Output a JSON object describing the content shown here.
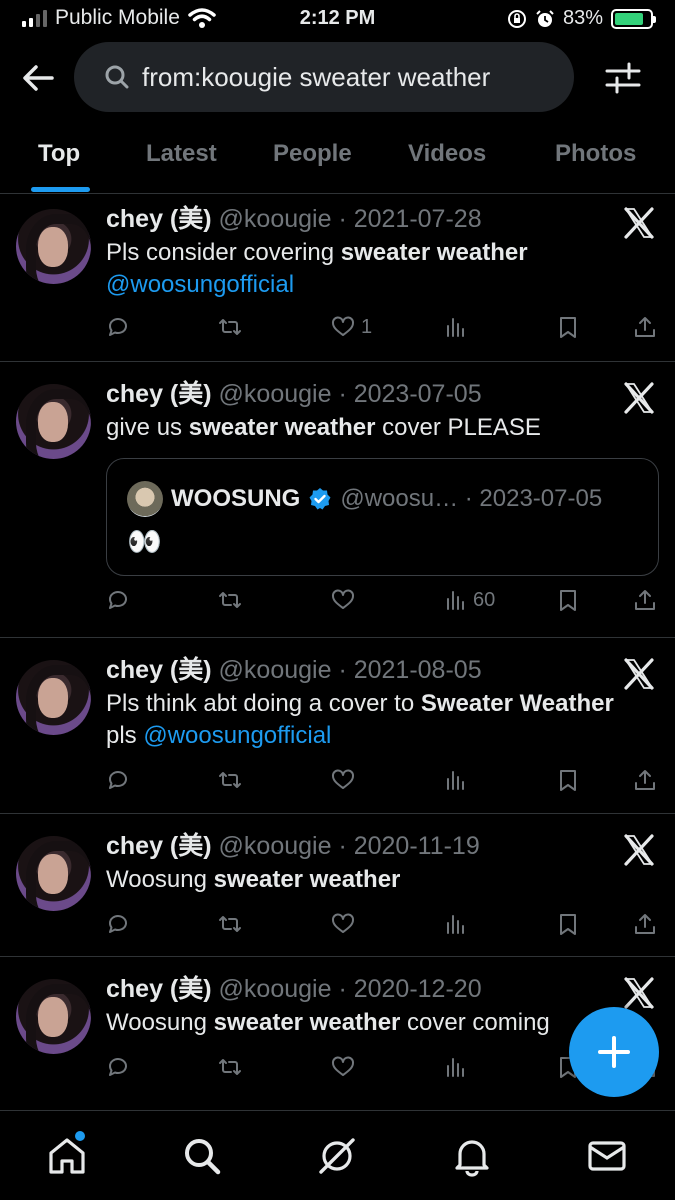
{
  "status_bar": {
    "carrier": "Public Mobile",
    "time": "2:12 PM",
    "battery": "83%",
    "battery_level": 0.83,
    "icons": [
      "signal-icon",
      "wifi-icon",
      "orientation-lock-icon",
      "alarm-icon",
      "battery-charging-icon"
    ]
  },
  "header": {
    "search_query": "from:koougie sweater weather",
    "icons": [
      "back-arrow-icon",
      "search-icon",
      "filter-sliders-icon"
    ]
  },
  "tabs": [
    {
      "label": "Top",
      "active": true
    },
    {
      "label": "Latest",
      "active": false
    },
    {
      "label": "People",
      "active": false
    },
    {
      "label": "Videos",
      "active": false
    },
    {
      "label": "Photos",
      "active": false
    }
  ],
  "tweets": [
    {
      "name": "chey (美)",
      "meta": "@koougie · 2021-07-28",
      "text_before": "Pls consider covering ",
      "text_bold": "sweater weather",
      "text_after": "",
      "mention": "@woosungofficial",
      "like_count": "1",
      "view_count": ""
    },
    {
      "name": "chey (美)",
      "meta": "@koougie · 2023-07-05",
      "text_before": "give us ",
      "text_bold": "sweater weather",
      "text_after": " cover PLEASE",
      "mention": "",
      "like_count": "",
      "view_count": "60",
      "quote": {
        "name": "WOOSUNG",
        "meta": "@woosu… · 2023-07-05",
        "text": "👀"
      }
    },
    {
      "name": "chey (美)",
      "meta": "@koougie · 2021-08-05",
      "text_before": "Pls think abt doing a cover to ",
      "text_bold": "Sweater Weather",
      "text_after": "",
      "line2_before": "pls ",
      "mention": "@woosungofficial",
      "like_count": "",
      "view_count": ""
    },
    {
      "name": "chey (美)",
      "meta": "@koougie · 2020-11-19",
      "text_before": "Woosung ",
      "text_bold": "sweater weather",
      "text_after": "",
      "mention": "",
      "like_count": "",
      "view_count": ""
    },
    {
      "name": "chey (美)",
      "meta": "@koougie · 2020-12-20",
      "text_before": "Woosung ",
      "text_bold": "sweater weather",
      "text_after": " cover coming",
      "mention": "",
      "like_count": "",
      "view_count": ""
    }
  ],
  "action_icons": [
    "reply-icon",
    "retweet-icon",
    "like-icon",
    "views-icon",
    "bookmark-icon",
    "share-icon"
  ],
  "fab": {
    "icon": "plus-icon"
  },
  "bottom_nav": [
    "home-icon",
    "explore-search-icon",
    "grok-icon",
    "notifications-bell-icon",
    "messages-envelope-icon"
  ],
  "colors": {
    "accent": "#1d9bf0",
    "background": "#000000",
    "muted": "#71767b",
    "text": "#e7e9ea"
  }
}
